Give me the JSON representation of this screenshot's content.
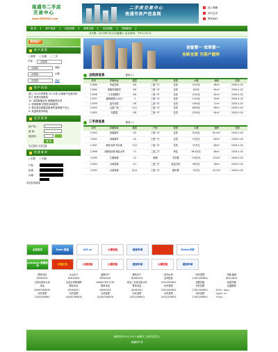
{
  "header": {
    "logo_line1": "南通市二手房",
    "logo_line2": "交易中心",
    "logo_url": "www.5583001.com",
    "banner_line1": "二手房交易中心",
    "banner_line2": "南通市房产信息网",
    "links": [
      "加入收藏",
      "设为主页",
      "联系我们"
    ]
  },
  "nav": [
    "首 页",
    "房产信息",
    "交易流程",
    "政策法规",
    "法定税费",
    "贷款服务"
  ],
  "topbar": "今天是：2010年7月10日星期六 北京时间：下午3:19:31",
  "login_strip": "我的帐户",
  "search_box": {
    "title": "房 产 搜 索",
    "radios": [
      "新房",
      "出租",
      "二手"
    ],
    "labels": [
      "户型：",
      "地段：",
      "价格："
    ],
    "selects": [
      "--请选择--",
      "--请选择--",
      "--请选择--",
      "--请选择--"
    ],
    "button": "搜索"
  },
  "dynamics": {
    "title": "房 产 动 态",
    "items": [
      "观工 20-30岁男性 10-15岁 从事房产买卖半年 中介 有意可来联系",
      "10. 本站新增业务 房屋租赁业务",
      "2. 你的房源 尽快在本网发布",
      "3. 提示各位房屋买卖请先咨询房产中心",
      "6. 欢迎转发本网站"
    ]
  },
  "member": {
    "title": "会 员 登 录",
    "user_label": "用户名：",
    "pass_label": "密  码：",
    "code_label": "验证码：",
    "login_btn": "登 录",
    "forget": "忘记密码  点击注册"
  },
  "quick": {
    "title": "快 速 查 询",
    "radios": [
      "出售",
      "出租"
    ],
    "labels": [
      "户型：",
      "区域：",
      "价格："
    ],
    "foot": "本站友情链接"
  },
  "promo": {
    "line1": "信誉第一 效率第一",
    "line2": "全新全意 为客户服务"
  },
  "rent": {
    "title": "出租房信息",
    "more": "更多>>",
    "headers": [
      "序号",
      "详细地址",
      "楼层",
      "户型",
      "类型",
      "价格",
      "面积",
      "日期"
    ],
    "rows": [
      [
        "12966",
        "专经花苑",
        "3/6",
        "二室一厅",
        "住宅",
        "2100元",
        "68m²",
        "2009-5-18"
      ],
      [
        "12964",
        "港源市域新村",
        "5/6",
        "二室一厅",
        "住宅",
        "650元",
        "64m²",
        "2009-5-18"
      ],
      [
        "12958",
        "小石桥新村",
        "4/6",
        "一室一厅",
        "住宅",
        "1200元",
        "62m²",
        "2009-5-18"
      ],
      [
        "12957",
        "城南家园14-604",
        "4",
        "三室一厅",
        "住宅",
        "1100元",
        "90m²",
        "2009-5-18"
      ],
      [
        "12956",
        "金元花苑",
        "2/6",
        "二室一厅",
        "住宅",
        "1650元",
        "72m²",
        "2009-5-18"
      ],
      [
        "12955",
        "云霞广场",
        "5/17",
        "二室一厅",
        "住宅",
        "6800元",
        "86m²",
        "2009-5-18"
      ],
      [
        "12954",
        "东胜园",
        "5/6",
        "二室一厅",
        "住宅",
        "1200元",
        "64m²",
        "2009-5-18"
      ]
    ]
  },
  "sale": {
    "title": "二手房信息",
    "more": "更多>>",
    "headers": [
      "序号",
      "详细地址",
      "楼层",
      "户型",
      "类型",
      "价格",
      "面积",
      "日期"
    ],
    "rows": [
      [
        "13002",
        "景瑞新村",
        "3/5",
        "三室一厅",
        "住宅",
        "62万元",
        "80.5m²",
        "2009-5-18"
      ],
      [
        "13001",
        "景瑞新村",
        "1/5",
        "三室一厅",
        "住宅",
        "55万元",
        "80m²",
        "2009-5-18"
      ],
      [
        "12997",
        "城东大院 专业房",
        "7/12",
        "二室一厅",
        "住宅",
        "55万元",
        "86m²",
        "2009-5-18"
      ],
      [
        "12996",
        "中南世纪城 南区大学城附近",
        "13",
        "二室二厅",
        "商住",
        "86.6万元",
        "88m²",
        "2009-5-18"
      ],
      [
        "12995",
        "汇丽新城",
        "10",
        "用铺",
        "写字楼",
        "126万元",
        "192m²",
        "2009-5-18"
      ],
      [
        "12994",
        "大润发城",
        "4/1",
        "二室二厅",
        "自住分析",
        "96万元",
        "58m²",
        "2009-5-18"
      ],
      [
        "12993",
        "大润发城",
        "8/14",
        "三室一厅",
        "楼中楼",
        "70万元",
        "55.3m²",
        "2009-5-18"
      ]
    ]
  },
  "ads": [
    [
      "北京四五",
      "flash 超值",
      "fd5.cn",
      "火爆招租",
      "链接申请",
      "",
      "Baidu百度"
    ],
    [
      "windows 清理助手",
      "中国红色",
      "火爆招租",
      "火爆招租",
      "链接申请",
      "火爆招租",
      "链接申请"
    ]
  ],
  "contacts": [
    "联系本站",
    "大山中介",
    "搜房中介",
    "联系中介",
    "合作伙伴",
    "代开发票",
    "贷款·融资",
    "85583001",
    "85612826",
    "85583001",
    "85583019",
    "台湾旺民",
    "13914399851",
    "85513829",
    "王府大厦本公司",
    "交友分享联谊群",
    "WWW.FIZZ.COM",
    "本站二手房交易公司",
    "13914399851",
    "加盟共融",
    "加盟共融",
    "本站",
    "联系本站",
    "联系本站",
    "联系本站",
    "代开发票",
    "代开发票",
    "百度推荐",
    "QQ567589876",
    "85583001",
    "85583001",
    "85583001",
    "13914399851",
    "13914399851",
    "Offer many",
    "代开发票",
    "代开发票",
    "代开发票",
    "代开发票",
    "代开发票",
    "代开发票",
    "types of",
    "13914399851",
    "QQ567589876",
    "QQ567589876",
    "13914399851",
    "13914399851",
    "13914399851",
    "flats..."
  ],
  "footer": {
    "line1": "版权所有2004-2009 南通市二手房交易中心",
    "line2": "南通房产网"
  }
}
